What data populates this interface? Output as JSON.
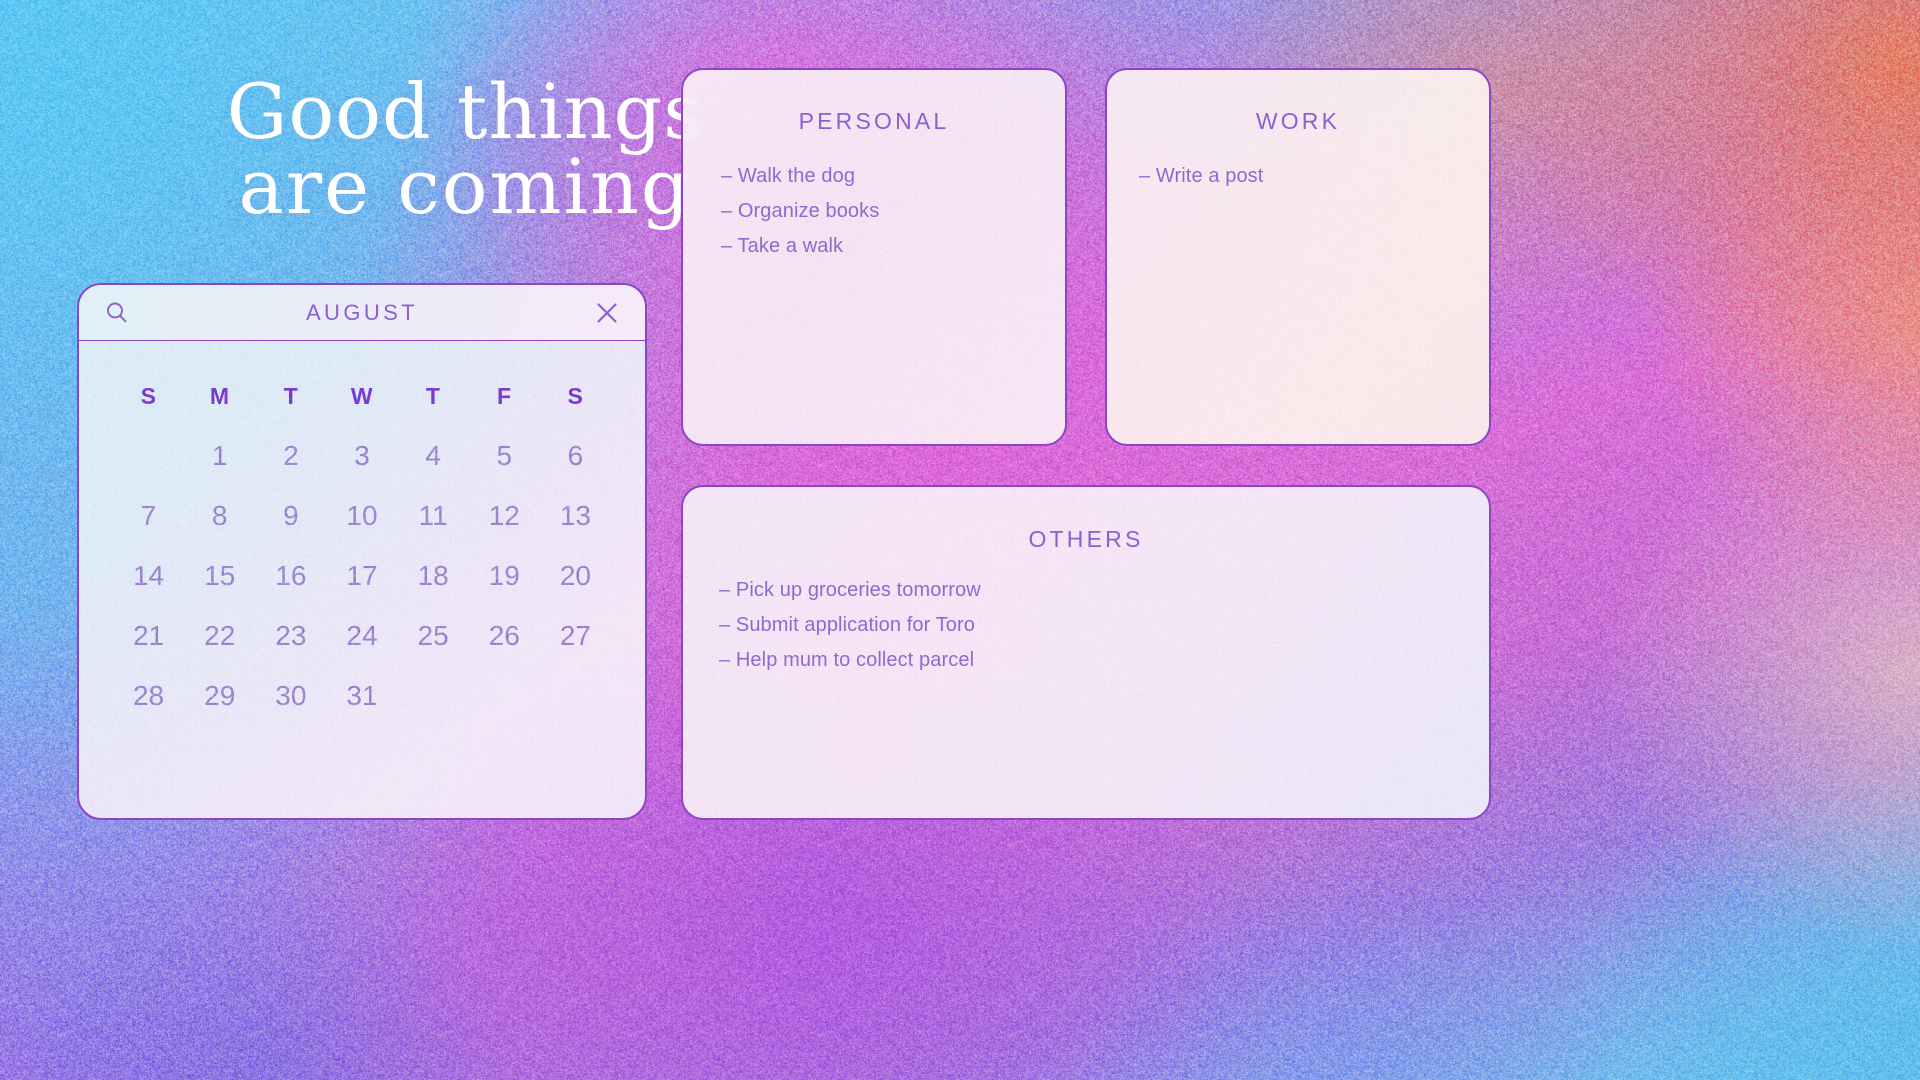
{
  "title": {
    "line1": "Good things",
    "line2": "are coming"
  },
  "colors": {
    "border": "#8b46c8",
    "heading": "#8e5fd0",
    "weekday": "#7a3ad2",
    "date": "#9a87cf",
    "task_text": "#8c6bd0",
    "title_text": "#ffffff"
  },
  "calendar": {
    "month_label": "AUGUST",
    "search_icon": "search-icon",
    "close_icon": "close-icon",
    "weekdays": [
      "S",
      "M",
      "T",
      "W",
      "T",
      "F",
      "S"
    ],
    "weeks": [
      [
        "",
        "1",
        "2",
        "3",
        "4",
        "5",
        "6"
      ],
      [
        "7",
        "8",
        "9",
        "10",
        "11",
        "12",
        "13"
      ],
      [
        "14",
        "15",
        "16",
        "17",
        "18",
        "19",
        "20"
      ],
      [
        "21",
        "22",
        "23",
        "24",
        "25",
        "26",
        "27"
      ],
      [
        "28",
        "29",
        "30",
        "31",
        "",
        "",
        ""
      ]
    ]
  },
  "cards": {
    "personal": {
      "title": "PERSONAL",
      "items": [
        "– Walk the dog",
        "– Organize books",
        "– Take a walk"
      ]
    },
    "work": {
      "title": "WORK",
      "items": [
        "– Write a post"
      ]
    },
    "others": {
      "title": "OTHERS",
      "items": [
        "– Pick up groceries tomorrow",
        "– Submit application for Toro",
        "– Help mum to collect parcel"
      ]
    }
  }
}
